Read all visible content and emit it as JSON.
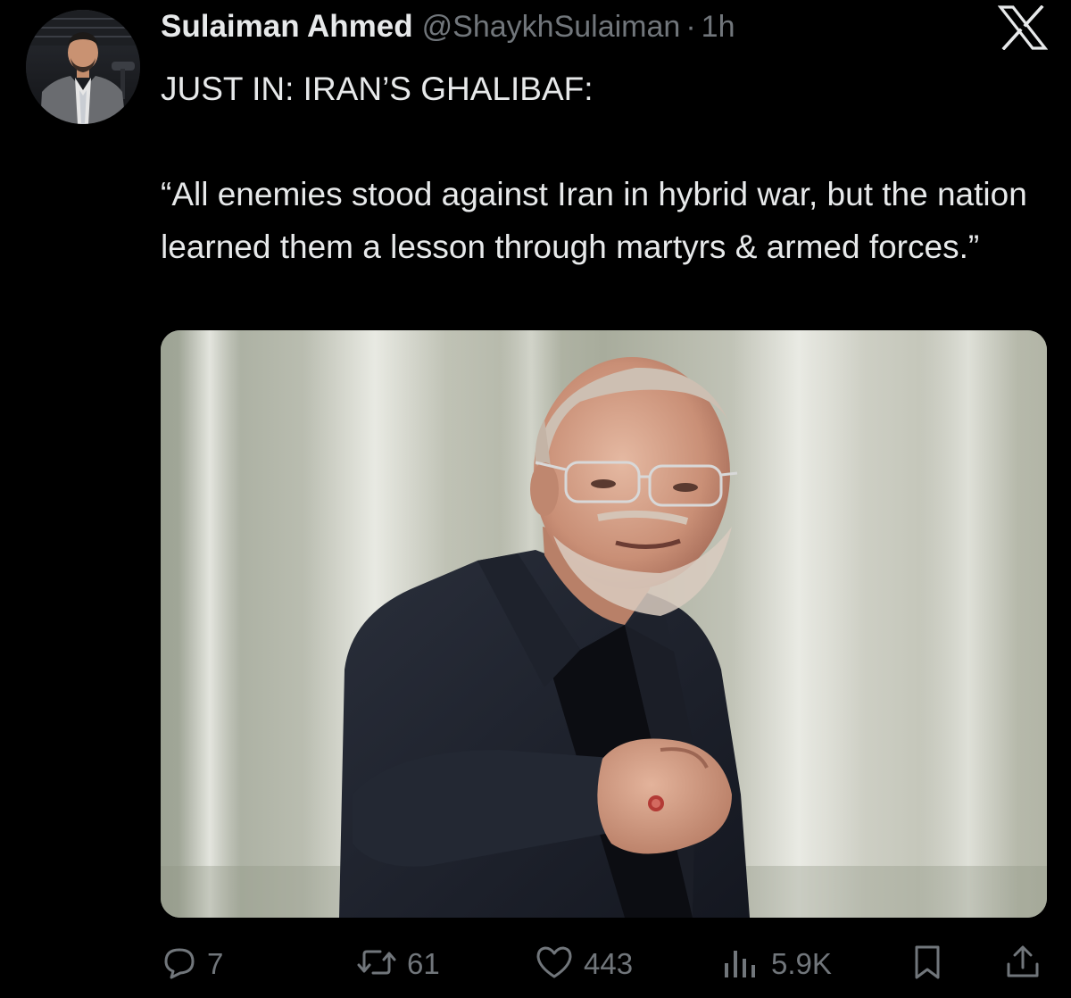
{
  "author": {
    "name": "Sulaiman Ahmed",
    "handle": "@ShaykhSulaiman",
    "separator": "·",
    "time": "1h"
  },
  "tweet": {
    "headline": "JUST IN: IRAN’S GHALIBAF:",
    "quote": "“All enemies stood against Iran in hybrid war, but the nation learned them a lesson through martyrs & armed forces.”"
  },
  "actions": {
    "replies": "7",
    "reposts": "61",
    "likes": "443",
    "views": "5.9K"
  },
  "icons": {
    "brand": "x-logo-icon",
    "reply": "reply-icon",
    "repost": "repost-icon",
    "like": "heart-icon",
    "views": "views-icon",
    "bookmark": "bookmark-icon",
    "share": "share-icon"
  },
  "colors": {
    "background": "#000000",
    "text_primary": "#e7e9ea",
    "text_secondary": "#71767b"
  }
}
